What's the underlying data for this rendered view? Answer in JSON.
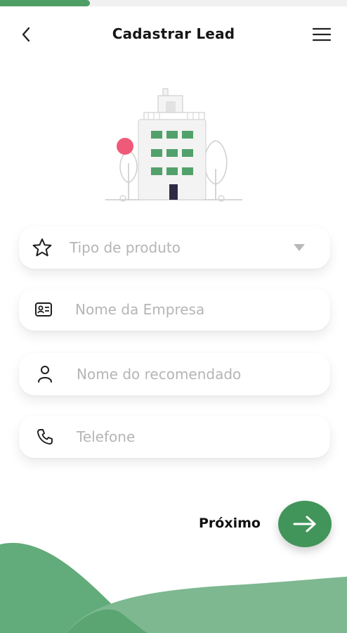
{
  "progress": {
    "fraction": 0.26
  },
  "header": {
    "title": "Cadastrar Lead",
    "back_icon": "chevron-left-icon",
    "menu_icon": "hamburger-menu-icon"
  },
  "form": {
    "product_type": {
      "placeholder": "Tipo de produto",
      "icon": "star-icon"
    },
    "company_name": {
      "placeholder": "Nome da Empresa",
      "icon": "id-card-icon"
    },
    "recommended_name": {
      "placeholder": "Nome do recomendado",
      "icon": "user-icon"
    },
    "phone": {
      "placeholder": "Telefone",
      "icon": "phone-icon"
    }
  },
  "footer": {
    "next_label": "Próximo",
    "next_icon": "arrow-right-icon"
  },
  "colors": {
    "accent": "#4f9e66",
    "button": "#42955a",
    "hill_dark": "#62ab7a",
    "hill_light": "#7db890",
    "dot": "#ef5a78"
  }
}
